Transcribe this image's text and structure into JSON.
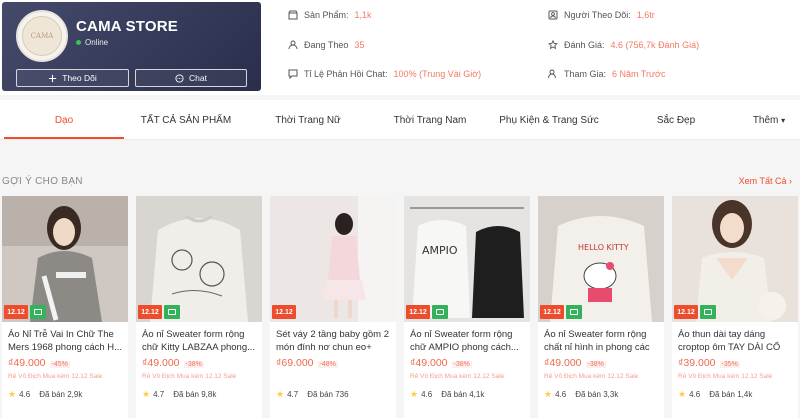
{
  "shop": {
    "name": "CAMA STORE",
    "status": "Online",
    "follow_label": "Theo Dõi",
    "chat_label": "Chat",
    "logo_text": "CAMA"
  },
  "stats": {
    "products": {
      "label": "Sản Phẩm:",
      "value": "1,1k"
    },
    "following": {
      "label": "Đang Theo",
      "value": "35"
    },
    "response": {
      "label": "Tỉ Lệ Phản Hồi Chat:",
      "value": "100% (Trung Vài Giờ)"
    },
    "followers": {
      "label": "Người Theo Dõi:",
      "value": "1,6tr"
    },
    "rating": {
      "label": "Đánh Giá:",
      "value": "4.6 (756,7k Đánh Giá)"
    },
    "joined": {
      "label": "Tham Gia:",
      "value": "6 Năm Trước"
    }
  },
  "tabs": [
    {
      "label": "Dạo"
    },
    {
      "label": "TẤT CẢ SẢN PHẨM"
    },
    {
      "label": "Thời Trang Nữ"
    },
    {
      "label": "Thời Trang Nam"
    },
    {
      "label": "Phụ Kiện & Trang Sức"
    },
    {
      "label": "Sắc Đẹp"
    },
    {
      "label": "Thêm"
    }
  ],
  "section": {
    "title": "GỢI Ý CHO BẠN",
    "see_all": "Xem Tất Cả"
  },
  "badge_1212": "12.12",
  "products": [
    {
      "name": "Áo Nỉ Trễ Vai In Chữ The Mers 1968 phong cách H...",
      "price": "₫49.000",
      "discount": "-45%",
      "tags": "Rẻ Vô Địch  Mua kèm  12.12 Sale",
      "rating": "4.6",
      "sold": "Đã bán 2,9k"
    },
    {
      "name": "Áo nỉ Sweater form rộng chữ Kitty LABZAA phong...",
      "price": "₫49.000",
      "discount": "-38%",
      "tags": "Rẻ Vô Địch  Mua kèm  12.12 Sale",
      "rating": "4.7",
      "sold": "Đã bán 9,8k"
    },
    {
      "name": "Sét váy 2 tầng baby gồm 2 món đính nơ chun eo+",
      "price": "₫69.000",
      "discount": "-48%",
      "tags": "",
      "rating": "4.7",
      "sold": "Đã bán 736"
    },
    {
      "name": "Áo nỉ Sweater form rộng chữ AMPIO phong cách...",
      "price": "₫49.000",
      "discount": "-38%",
      "tags": "Rẻ Vô Địch  Mua kèm  12.12 Sale",
      "rating": "4.6",
      "sold": "Đã bán 4,1k"
    },
    {
      "name": "Áo nỉ Sweater form rộng chất nỉ hình in phong các",
      "price": "₫49.000",
      "discount": "-38%",
      "tags": "Rẻ Vô Địch  Mua kèm  12.12 Sale",
      "rating": "4.6",
      "sold": "Đã bán 3,3k"
    },
    {
      "name": "Áo thun dài tay dáng croptop ôm TAY DÀI CỔ",
      "price": "₫39.000",
      "discount": "-35%",
      "tags": "Rẻ Vô Địch  Mua kèm  12.12 Sale",
      "rating": "4.6",
      "sold": "Đã bán 1,4k"
    }
  ],
  "colors": {
    "accent": "#ee4d2d",
    "shop_card": "#2c3150",
    "mall_green": "#35b15b",
    "star": "#ffce3d"
  },
  "icons": [
    "store-icon",
    "user-icon",
    "chat-bubble-icon",
    "followers-icon",
    "star-outline-icon",
    "user-plus-icon",
    "chevron-down-icon"
  ]
}
